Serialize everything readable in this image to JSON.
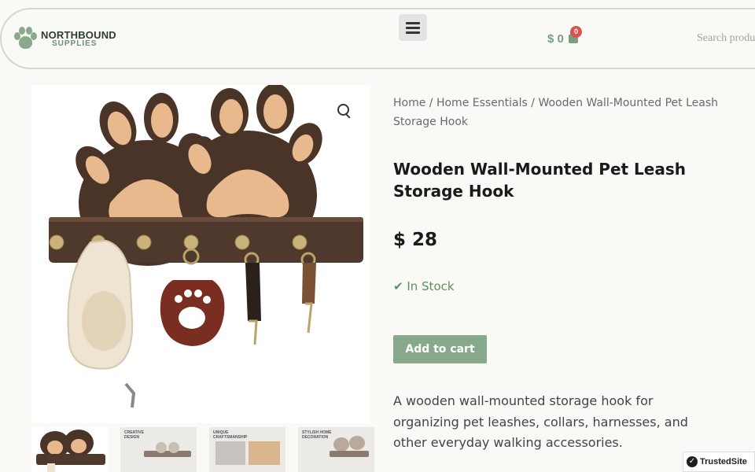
{
  "header": {
    "logo_name": "NORTHBOUND",
    "logo_sub": "SUPPLIES",
    "cart_total": "$ 0",
    "cart_count": "0",
    "search_placeholder": "Search products…"
  },
  "breadcrumb": {
    "home": "Home",
    "separator": " / ",
    "category": "Home Essentials",
    "current": "Wooden Wall-Mounted Pet Leash Storage Hook"
  },
  "product": {
    "title": "Wooden Wall-Mounted Pet Leash Storage Hook",
    "price": "$ 28",
    "stock": "✔ In Stock",
    "add_to_cart": "Add to cart",
    "description": "A wooden wall-mounted storage hook for organizing pet leashes, collars, harnesses, and other everyday walking accessories."
  },
  "thumbnails": [
    {
      "caption": ""
    },
    {
      "caption": "CREATIVE DESIGN"
    },
    {
      "caption": "UNIQUE CRAFTSMANSHIP"
    },
    {
      "caption": "STYLISH HOME DECORATION"
    }
  ],
  "badge": {
    "label": "TrustedSite"
  },
  "colors": {
    "accent": "#88a98c",
    "stock": "#5e8f63",
    "badge": "#d9534f",
    "wood_dark": "#4a3428",
    "wood_light": "#e8b98c"
  }
}
